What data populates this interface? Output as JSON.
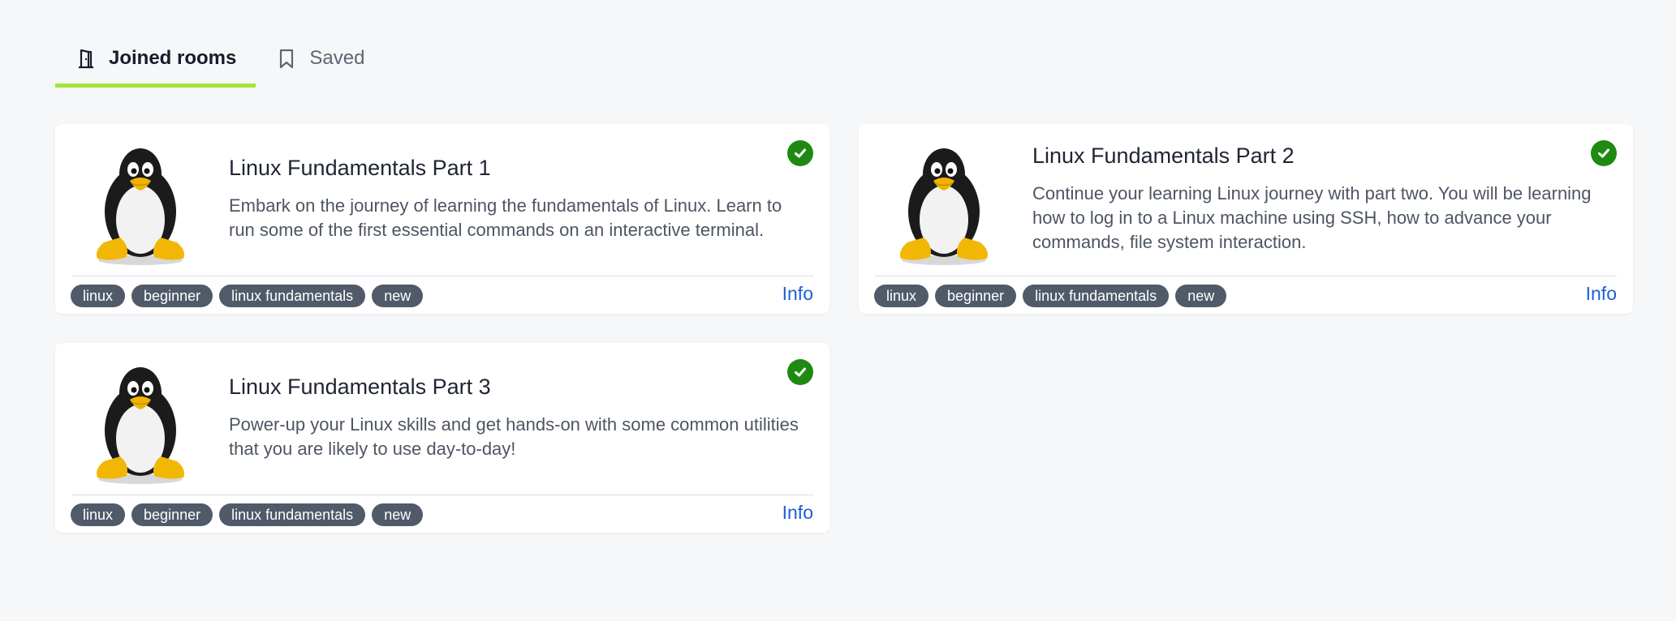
{
  "tabs": [
    {
      "label": "Joined rooms",
      "icon": "door-icon",
      "active": true
    },
    {
      "label": "Saved",
      "icon": "bookmark-icon",
      "active": false
    }
  ],
  "colors": {
    "accent_underline": "#a3e635",
    "check_badge": "#1f8a12",
    "tag_bg": "#505a69",
    "info_link": "#1c5fd9"
  },
  "rooms": [
    {
      "title": "Linux Fundamentals Part 1",
      "description": "Embark on the journey of learning the fundamentals of Linux. Learn to run some of the first essential commands on an interactive terminal.",
      "icon": "tux-penguin-icon",
      "completed": true,
      "tags": [
        "linux",
        "beginner",
        "linux fundamentals",
        "new"
      ],
      "info_label": "Info"
    },
    {
      "title": "Linux Fundamentals Part 2",
      "description": "Continue your learning Linux journey with part two. You will be learning how to log in to a Linux machine using SSH, how to advance your commands, file system interaction.",
      "icon": "tux-penguin-icon",
      "completed": true,
      "tags": [
        "linux",
        "beginner",
        "linux fundamentals",
        "new"
      ],
      "info_label": "Info"
    },
    {
      "title": "Linux Fundamentals Part 3",
      "description": "Power-up your Linux skills and get hands-on with some common utilities that you are likely to use day-to-day!",
      "icon": "tux-penguin-icon",
      "completed": true,
      "tags": [
        "linux",
        "beginner",
        "linux fundamentals",
        "new"
      ],
      "info_label": "Info"
    }
  ]
}
